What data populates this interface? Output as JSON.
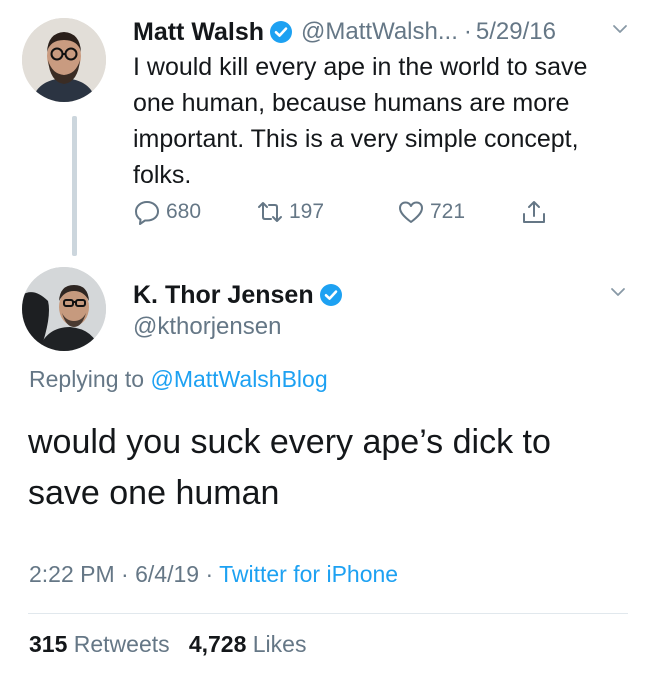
{
  "parent_tweet": {
    "author_name": "Matt Walsh",
    "handle": "@MattWalsh...",
    "separator": "·",
    "date": "5/29/16",
    "text": "I would kill every ape in the world to save one human, because humans are more important. This is a very simple concept, folks.",
    "reply_count": "680",
    "retweet_count": "197",
    "like_count": "721"
  },
  "main_tweet": {
    "author_name": "K. Thor Jensen",
    "handle": "@kthorjensen",
    "replying_prefix": "Replying to ",
    "replying_to": "@MattWalshBlog",
    "text": "would you suck every ape’s dick to save one human",
    "time": "2:22 PM",
    "date": "6/4/19",
    "separator": "·",
    "source": "Twitter for iPhone",
    "retweets_value": "315",
    "retweets_label": "Retweets",
    "likes_value": "4,728",
    "likes_label": "Likes"
  },
  "colors": {
    "link": "#1da1f2",
    "muted": "#657786",
    "text": "#14171a"
  }
}
